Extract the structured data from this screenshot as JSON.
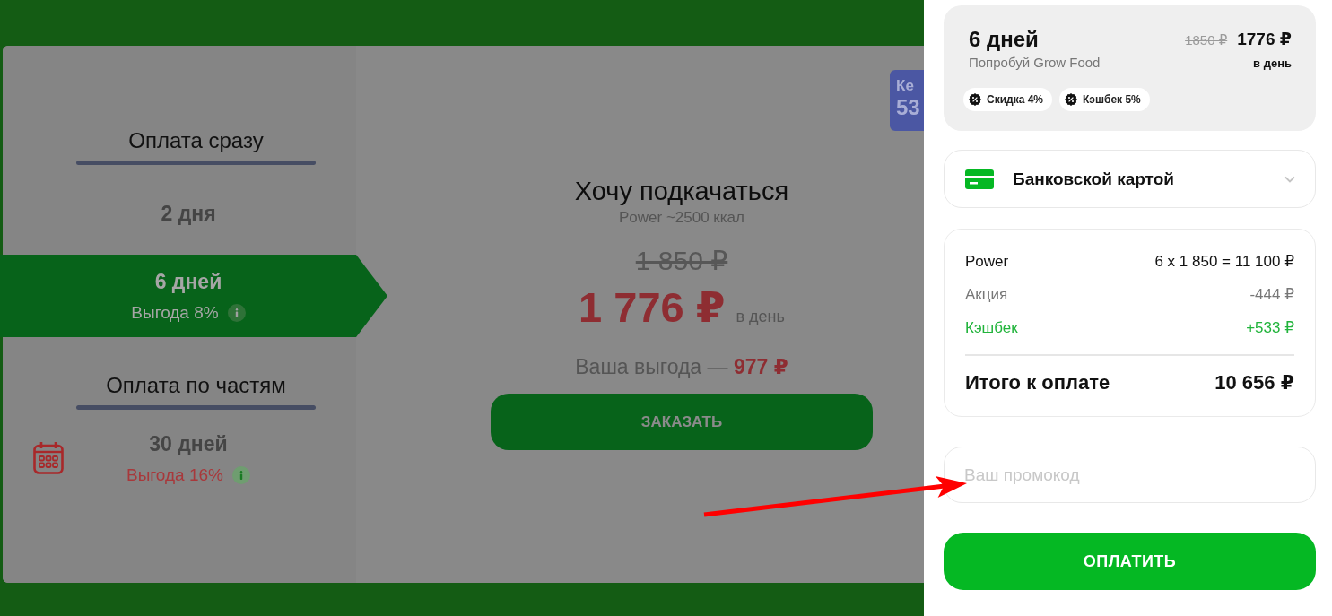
{
  "plan_picker": {
    "groups": [
      {
        "title": "Оплата сразу",
        "options": [
          {
            "label": "2 дня",
            "kind": "one_time",
            "selected": false
          },
          {
            "label": "6 дней",
            "benefit": "Выгода 8%",
            "kind": "one_time",
            "selected": true
          }
        ]
      },
      {
        "title": "Оплата по частям",
        "options": [
          {
            "label": "30 дней",
            "benefit": "Выгода 16%",
            "kind": "installment",
            "selected": false
          }
        ]
      }
    ]
  },
  "plan": {
    "title": "Хочу подкачаться",
    "subtitle": "Power ~2500 ккал",
    "old_price": "1 850 ₽",
    "price": "1 776 ₽",
    "price_unit": "в день",
    "savings": "Ваша выгода — **977 ₽**",
    "order_button": "ЗАКАЗАТЬ"
  },
  "cashback_badge": {
    "line_1": "Ке",
    "line_2": "53"
  },
  "checkout": {
    "summary": {
      "title": "6 дней",
      "subtitle": "Попробуй Grow Food",
      "old_price": "1850 ₽",
      "price": "1776 ₽",
      "price_unit": "в день",
      "chips": [
        "Скидка 4%",
        "Кэшбек 5%"
      ]
    },
    "payment_method": {
      "label": "Банковской картой"
    },
    "breakdown": {
      "rows": [
        {
          "label": "Power",
          "value": "6 x 1 850 = 11 100 ₽",
          "kind": "item"
        },
        {
          "label": "Акция",
          "value": "-444 ₽",
          "kind": "discount"
        },
        {
          "label": "Кэшбек",
          "value": "+533 ₽",
          "kind": "cashback"
        }
      ],
      "total": {
        "label": "Итого к оплате",
        "value": "10 656 ₽"
      }
    },
    "promo": {
      "placeholder": "Ваш промокод"
    },
    "pay_button": "ОПЛАТИТЬ"
  }
}
